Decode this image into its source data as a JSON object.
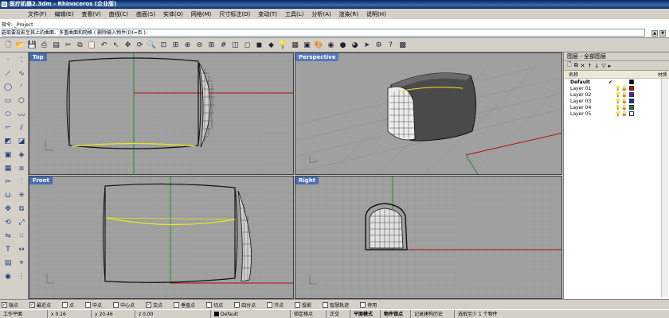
{
  "window": {
    "title": "医疗机器2.3dm - Rhinoceros (企业版)"
  },
  "menu": [
    "文件(F)",
    "编辑(E)",
    "查看(V)",
    "曲线(C)",
    "曲面(S)",
    "实体(O)",
    "网格(M)",
    "尺寸标注(D)",
    "变动(T)",
    "工具(L)",
    "分析(A)",
    "渲染(R)",
    "说明(H)"
  ],
  "command": {
    "line1": "指令: _Project",
    "line2": "选取要投影至其上的曲面、多重曲面和网格 ( 删除输入物件(D)=否 ):"
  },
  "viewports": {
    "top": "Top",
    "perspective": "Perspective",
    "front": "Front",
    "right": "Right"
  },
  "layers": {
    "title": "图层 - 全部图层",
    "header_name": "名称",
    "header_material": "材质",
    "rows": [
      {
        "name": "Default",
        "color": "#000000",
        "current": true
      },
      {
        "name": "Layer 01",
        "color": "#cc0000",
        "current": false
      },
      {
        "name": "Layer 02",
        "color": "#6a1a9a",
        "current": false
      },
      {
        "name": "Layer 03",
        "color": "#1030c0",
        "current": false
      },
      {
        "name": "Layer 04",
        "color": "#108040",
        "current": false
      },
      {
        "name": "Layer 05",
        "color": "#ffffff",
        "current": false
      }
    ]
  },
  "snaps": [
    {
      "label": "端点",
      "checked": true
    },
    {
      "label": "最近点",
      "checked": true
    },
    {
      "label": "点",
      "checked": false
    },
    {
      "label": "中点",
      "checked": false
    },
    {
      "label": "中心点",
      "checked": false
    },
    {
      "label": "交点",
      "checked": true
    },
    {
      "label": "垂直点",
      "checked": false
    },
    {
      "label": "切点",
      "checked": false
    },
    {
      "label": "四分点",
      "checked": false
    },
    {
      "label": "节点",
      "checked": false
    },
    {
      "label": "投影",
      "checked": false
    },
    {
      "label": "智慧轨迹",
      "checked": false
    },
    {
      "label": "停用",
      "checked": false
    }
  ],
  "status": {
    "plane": "工作平面",
    "x": "x 0.16",
    "y": "y 20.46",
    "z": "z 0.00",
    "layer": "Default",
    "lock": "锁定格点",
    "ortho": "正交",
    "planar": "平面模式",
    "osnap": "物件锁点",
    "history": "记录建构历史",
    "select": "选取至少 1 个物件"
  }
}
